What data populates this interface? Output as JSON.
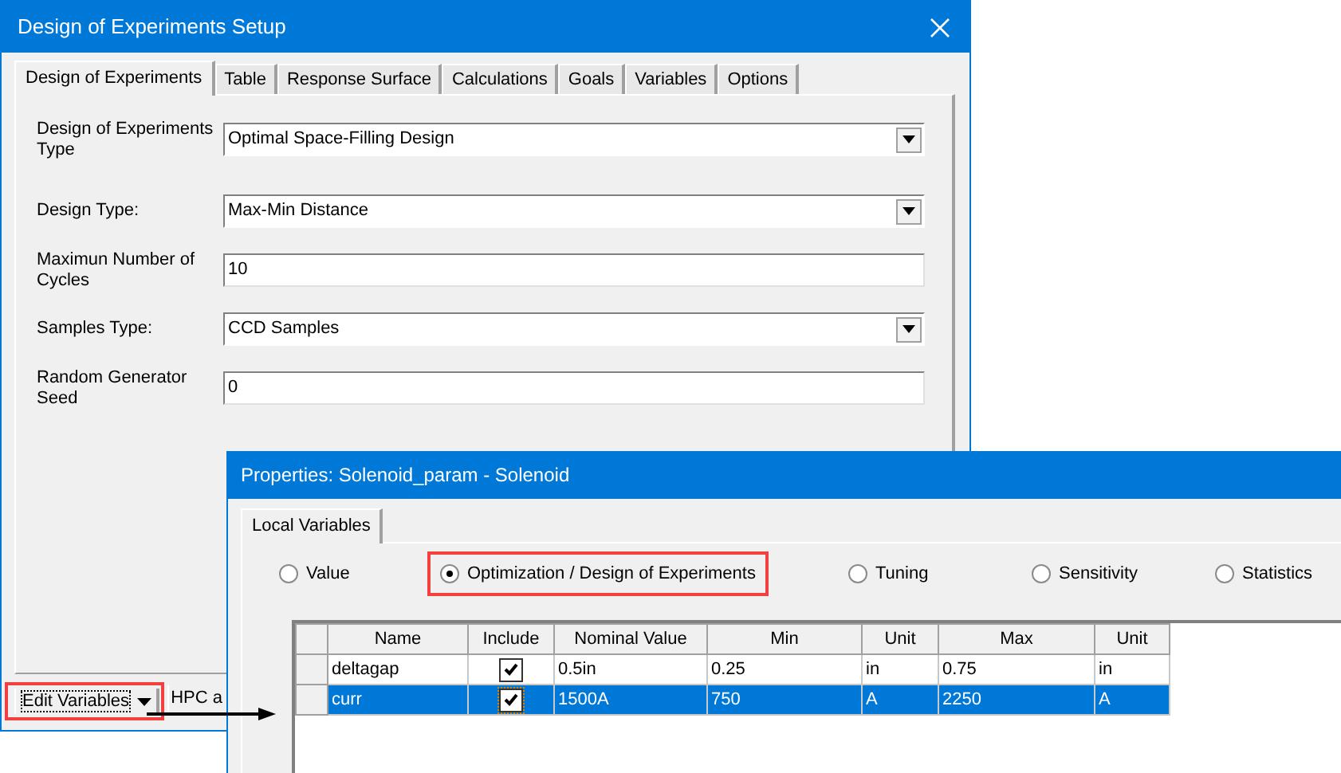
{
  "setup_dialog": {
    "title": "Design of Experiments Setup",
    "tabs": [
      {
        "label": "Design of Experiments",
        "selected": true
      },
      {
        "label": "Table",
        "selected": false
      },
      {
        "label": "Response Surface",
        "selected": false
      },
      {
        "label": "Calculations",
        "selected": false
      },
      {
        "label": "Goals",
        "selected": false
      },
      {
        "label": "Variables",
        "selected": false
      },
      {
        "label": "Options",
        "selected": false
      }
    ],
    "fields": [
      {
        "kind": "dropdown",
        "label": "Design of Experiments Type",
        "value": "Optimal Space-Filling Design"
      },
      {
        "kind": "dropdown",
        "label": "Design Type:",
        "value": "Max-Min Distance"
      },
      {
        "kind": "text",
        "label": "Maximun Number of Cycles",
        "value": "10"
      },
      {
        "kind": "dropdown",
        "label": "Samples Type:",
        "value": "CCD Samples"
      },
      {
        "kind": "text",
        "label": "Random Generator Seed",
        "value": "0"
      }
    ],
    "buttons": [
      {
        "kind": "menu",
        "label": "Edit Variables",
        "highlighted": true
      },
      {
        "kind": "plain",
        "label": "HPC a",
        "highlighted": false
      }
    ]
  },
  "properties_dialog": {
    "title": "Properties: Solenoid_param - Solenoid",
    "tabs": [
      {
        "label": "Local Variables",
        "selected": true
      }
    ],
    "modes": [
      {
        "label": "Value",
        "selected": false,
        "highlighted": false
      },
      {
        "label": "Optimization / Design of Experiments",
        "selected": true,
        "highlighted": true
      },
      {
        "label": "Tuning",
        "selected": false,
        "highlighted": false
      },
      {
        "label": "Sensitivity",
        "selected": false,
        "highlighted": false
      },
      {
        "label": "Statistics",
        "selected": false,
        "highlighted": false
      }
    ],
    "table": {
      "columns": [
        "Name",
        "Include",
        "Nominal Value",
        "Min",
        "Unit",
        "Max",
        "Unit"
      ],
      "rows": [
        {
          "selected": false,
          "cells": [
            {
              "kind": "text",
              "text": "deltagap"
            },
            {
              "kind": "checkbox",
              "checked": true
            },
            {
              "kind": "text",
              "text": "0.5in"
            },
            {
              "kind": "text",
              "text": "0.25"
            },
            {
              "kind": "text",
              "text": "in"
            },
            {
              "kind": "text",
              "text": "0.75"
            },
            {
              "kind": "text",
              "text": "in"
            }
          ]
        },
        {
          "selected": true,
          "cells": [
            {
              "kind": "text",
              "text": "curr"
            },
            {
              "kind": "checkbox",
              "checked": true
            },
            {
              "kind": "text",
              "text": "1500A"
            },
            {
              "kind": "text",
              "text": "750"
            },
            {
              "kind": "text",
              "text": "A"
            },
            {
              "kind": "text",
              "text": "2250"
            },
            {
              "kind": "text",
              "text": "A"
            }
          ]
        }
      ]
    }
  }
}
